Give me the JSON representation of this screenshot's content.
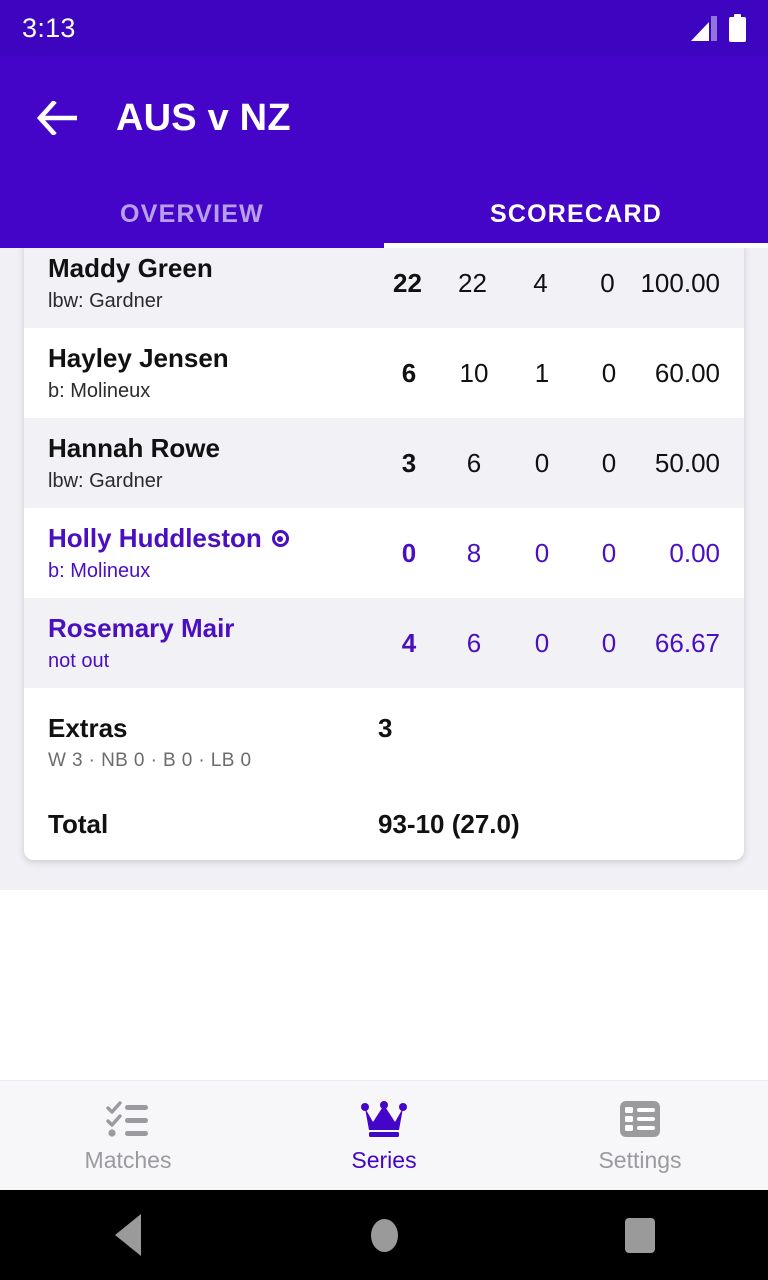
{
  "status_bar": {
    "time": "3:13",
    "signal_icon": "signal-cellular-icon",
    "battery_icon": "battery-full-icon"
  },
  "app_bar": {
    "back_icon": "back-arrow-icon",
    "title": "AUS v NZ"
  },
  "tabs": [
    {
      "label": "OVERVIEW",
      "active": false
    },
    {
      "label": "SCORECARD",
      "active": true
    }
  ],
  "colors": {
    "primary": "#4405c8",
    "status_bar": "#3d05c0",
    "accent_text": "#4a0fc0",
    "row_tint": "#f2f1f6",
    "page_background": "#f1f0f5"
  },
  "scorecard": {
    "batters": [
      {
        "name": "Maddy Green",
        "dismissal": "lbw: Gardner",
        "runs": "22",
        "balls": "22",
        "fours": "4",
        "sixes": "0",
        "strike_rate": "100.00",
        "not_out": false,
        "on_strike": false
      },
      {
        "name": "Hayley Jensen",
        "dismissal": "b: Molineux",
        "runs": "6",
        "balls": "10",
        "fours": "1",
        "sixes": "0",
        "strike_rate": "60.00",
        "not_out": false,
        "on_strike": false
      },
      {
        "name": "Hannah Rowe",
        "dismissal": "lbw: Gardner",
        "runs": "3",
        "balls": "6",
        "fours": "0",
        "sixes": "0",
        "strike_rate": "50.00",
        "not_out": false,
        "on_strike": false
      },
      {
        "name": "Holly Huddleston",
        "dismissal": "b: Molineux",
        "runs": "0",
        "balls": "8",
        "fours": "0",
        "sixes": "0",
        "strike_rate": "0.00",
        "not_out": false,
        "on_strike": true
      },
      {
        "name": "Rosemary Mair",
        "dismissal": "not out",
        "runs": "4",
        "balls": "6",
        "fours": "0",
        "sixes": "0",
        "strike_rate": "66.67",
        "not_out": true,
        "on_strike": false
      }
    ],
    "extras": {
      "label": "Extras",
      "value": "3",
      "detail": "W 3 · NB 0 · B 0 · LB 0"
    },
    "total": {
      "label": "Total",
      "value": "93-10 (27.0)"
    }
  },
  "bottom_nav": [
    {
      "label": "Matches",
      "icon": "playlist-check-icon",
      "active": false
    },
    {
      "label": "Series",
      "icon": "crown-icon",
      "active": true
    },
    {
      "label": "Settings",
      "icon": "view-list-icon",
      "active": false
    }
  ],
  "system_nav": {
    "back_icon": "triangle-back-icon",
    "home_icon": "circle-home-icon",
    "recents_icon": "square-recents-icon"
  }
}
